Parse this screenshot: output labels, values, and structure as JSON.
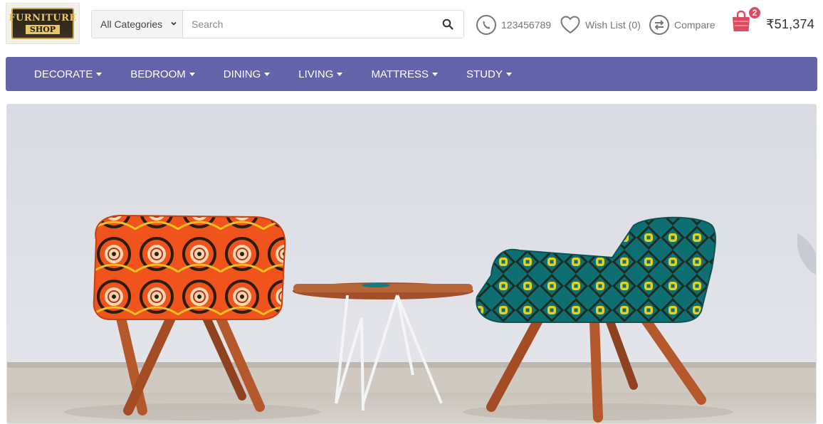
{
  "header": {
    "logo": {
      "line1": "FURNITURE",
      "line2": "SHOP"
    },
    "search": {
      "category_selected": "All Categories",
      "placeholder": "Search",
      "value": ""
    },
    "phone": "123456789",
    "wishlist_label": "Wish List (0)",
    "compare_label": "Compare",
    "cart": {
      "count": "2",
      "total": "₹51,374"
    }
  },
  "nav": {
    "items": [
      {
        "label": "DECORATE"
      },
      {
        "label": "BEDROOM"
      },
      {
        "label": "DINING"
      },
      {
        "label": "LIVING"
      },
      {
        "label": "MATTRESS"
      },
      {
        "label": "STUDY"
      }
    ]
  },
  "hero": {
    "image": "banner-photo-two-patterned-armchairs-with-side-table"
  },
  "colors": {
    "nav_bg": "#6464aa",
    "badge": "#e04a5f",
    "cart_icon": "#e04a5f",
    "text_muted": "#777777"
  },
  "icons": [
    "search-icon",
    "phone-icon",
    "heart-icon",
    "compare-icon",
    "shopping-bag-icon",
    "caret-down-icon"
  ]
}
